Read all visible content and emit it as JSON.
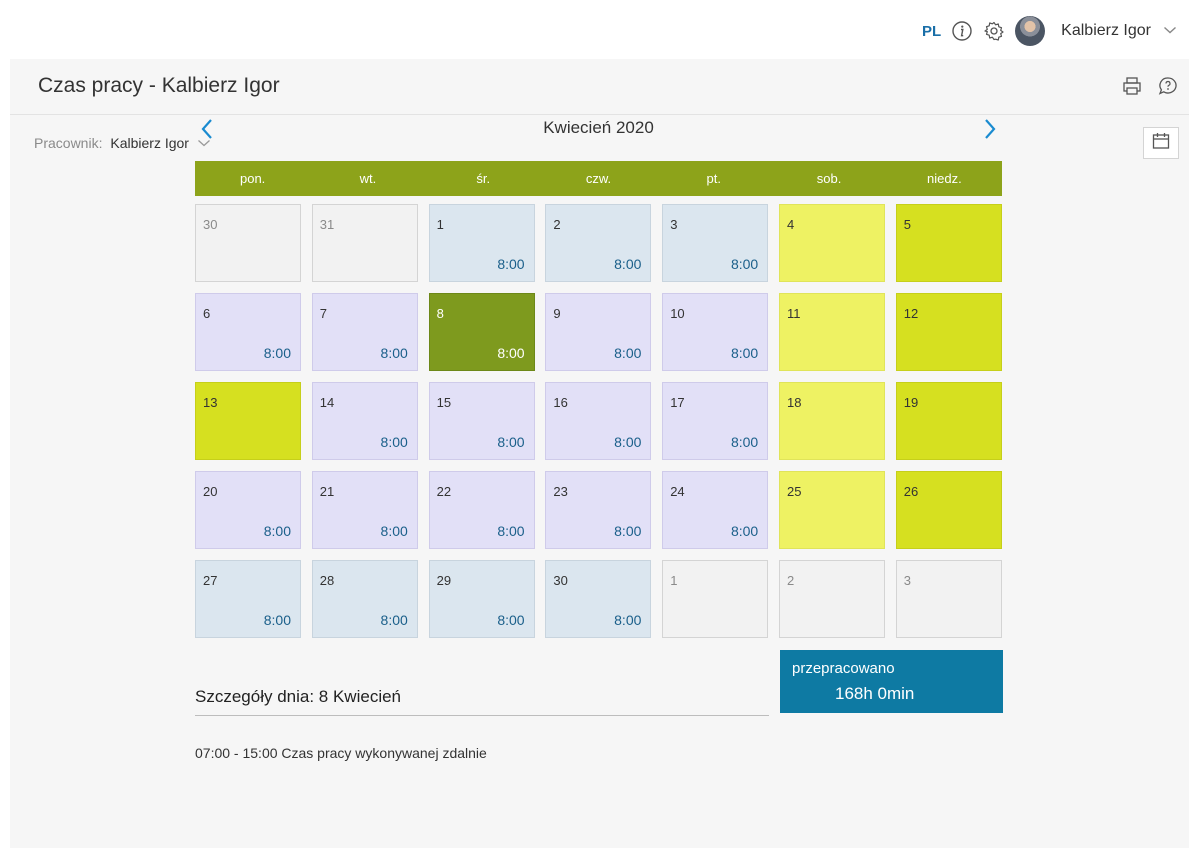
{
  "header": {
    "language": "PL",
    "user_name": "Kalbierz Igor",
    "icons": [
      "info-icon",
      "gear-icon",
      "avatar",
      "chevron-down-icon"
    ]
  },
  "page": {
    "title": "Czas pracy - Kalbierz Igor",
    "actions": [
      "printer-icon",
      "help-bubble-icon"
    ]
  },
  "filter": {
    "employee_label": "Pracownik:",
    "employee_value": "Kalbierz Igor"
  },
  "calendar": {
    "month_title": "Kwiecień 2020",
    "weekdays": [
      "pon.",
      "wt.",
      "śr.",
      "czw.",
      "pt.",
      "sob.",
      "niedz."
    ],
    "colors": {
      "header_green": "#8da31a",
      "selected": "#7e9a1e",
      "saturday": "#eef263",
      "sunday": "#d6e020",
      "remote": "#dbe6ef",
      "work": "#e2e0f7",
      "outside": "#f2f2f2"
    },
    "days": [
      {
        "n": "30",
        "h": "",
        "t": "out"
      },
      {
        "n": "31",
        "h": "",
        "t": "out"
      },
      {
        "n": "1",
        "h": "8:00",
        "t": "remote"
      },
      {
        "n": "2",
        "h": "8:00",
        "t": "remote"
      },
      {
        "n": "3",
        "h": "8:00",
        "t": "remote"
      },
      {
        "n": "4",
        "h": "",
        "t": "sat"
      },
      {
        "n": "5",
        "h": "",
        "t": "sun"
      },
      {
        "n": "6",
        "h": "8:00",
        "t": "work"
      },
      {
        "n": "7",
        "h": "8:00",
        "t": "work"
      },
      {
        "n": "8",
        "h": "8:00",
        "t": "selected"
      },
      {
        "n": "9",
        "h": "8:00",
        "t": "work"
      },
      {
        "n": "10",
        "h": "8:00",
        "t": "work"
      },
      {
        "n": "11",
        "h": "",
        "t": "sat"
      },
      {
        "n": "12",
        "h": "",
        "t": "sun"
      },
      {
        "n": "13",
        "h": "",
        "t": "sun"
      },
      {
        "n": "14",
        "h": "8:00",
        "t": "work"
      },
      {
        "n": "15",
        "h": "8:00",
        "t": "work"
      },
      {
        "n": "16",
        "h": "8:00",
        "t": "work"
      },
      {
        "n": "17",
        "h": "8:00",
        "t": "work"
      },
      {
        "n": "18",
        "h": "",
        "t": "sat"
      },
      {
        "n": "19",
        "h": "",
        "t": "sun"
      },
      {
        "n": "20",
        "h": "8:00",
        "t": "work"
      },
      {
        "n": "21",
        "h": "8:00",
        "t": "work"
      },
      {
        "n": "22",
        "h": "8:00",
        "t": "work"
      },
      {
        "n": "23",
        "h": "8:00",
        "t": "work"
      },
      {
        "n": "24",
        "h": "8:00",
        "t": "work"
      },
      {
        "n": "25",
        "h": "",
        "t": "sat"
      },
      {
        "n": "26",
        "h": "",
        "t": "sun"
      },
      {
        "n": "27",
        "h": "8:00",
        "t": "remote"
      },
      {
        "n": "28",
        "h": "8:00",
        "t": "remote"
      },
      {
        "n": "29",
        "h": "8:00",
        "t": "remote"
      },
      {
        "n": "30",
        "h": "8:00",
        "t": "remote"
      },
      {
        "n": "1",
        "h": "",
        "t": "out"
      },
      {
        "n": "2",
        "h": "",
        "t": "out"
      },
      {
        "n": "3",
        "h": "",
        "t": "out"
      }
    ]
  },
  "summary": {
    "label": "przepracowano",
    "value": "168h 0min"
  },
  "details": {
    "title": "Szczegóły dnia: 8 Kwiecień",
    "entry": "07:00 - 15:00 Czas pracy wykonywanej zdalnie"
  }
}
